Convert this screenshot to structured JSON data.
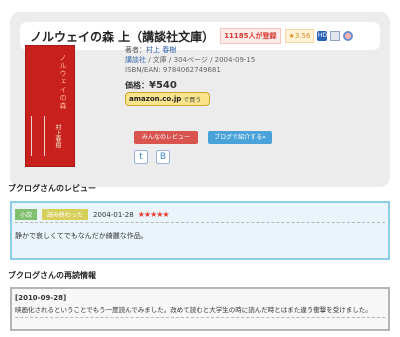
{
  "book": {
    "title": "ノルウェイの森 上（講談社文庫）",
    "registered_badge": "11185人が登録",
    "rating_badge": "★3.56",
    "cover": {
      "title": "ノルウェイの森",
      "author": "村上春樹"
    },
    "author_label": "著者：",
    "author": "村上 春樹",
    "publisher": "講談社",
    "details": " / 文庫 / 304ページ / 2004-09-15",
    "isbn": "ISBN/EAN: 9784062749681",
    "price_label": "価格：",
    "price": "¥540",
    "amazon_button": "amazon.co.jp",
    "amazon_suffix": "で買う",
    "review_button": "みんなのレビュー",
    "blog_button": "ブログで紹介する»"
  },
  "icons": {
    "hd": "HD",
    "twitter": "t",
    "hatena": "B"
  },
  "review_section": {
    "heading": "ブクログさんのレビュー",
    "category_tag": "小説",
    "status_tag": "読み終わった",
    "date": "2004-01-28",
    "stars": "★★★★★",
    "text": "静かで哀しくてでもなんだか綺麗な作品。"
  },
  "reread_section": {
    "heading": "ブクログさんの再読情報",
    "date": "[2010-09-28]",
    "text": "映画化されるということでもう一度読んでみました。改めて読むと大学生の時に読んだ時とはまた違う衝撃を受けました。"
  },
  "colors": {
    "accent_red": "#d9534f",
    "accent_blue": "#4aa3d8",
    "review_border": "#8ccde8",
    "star": "#e63a2f"
  }
}
